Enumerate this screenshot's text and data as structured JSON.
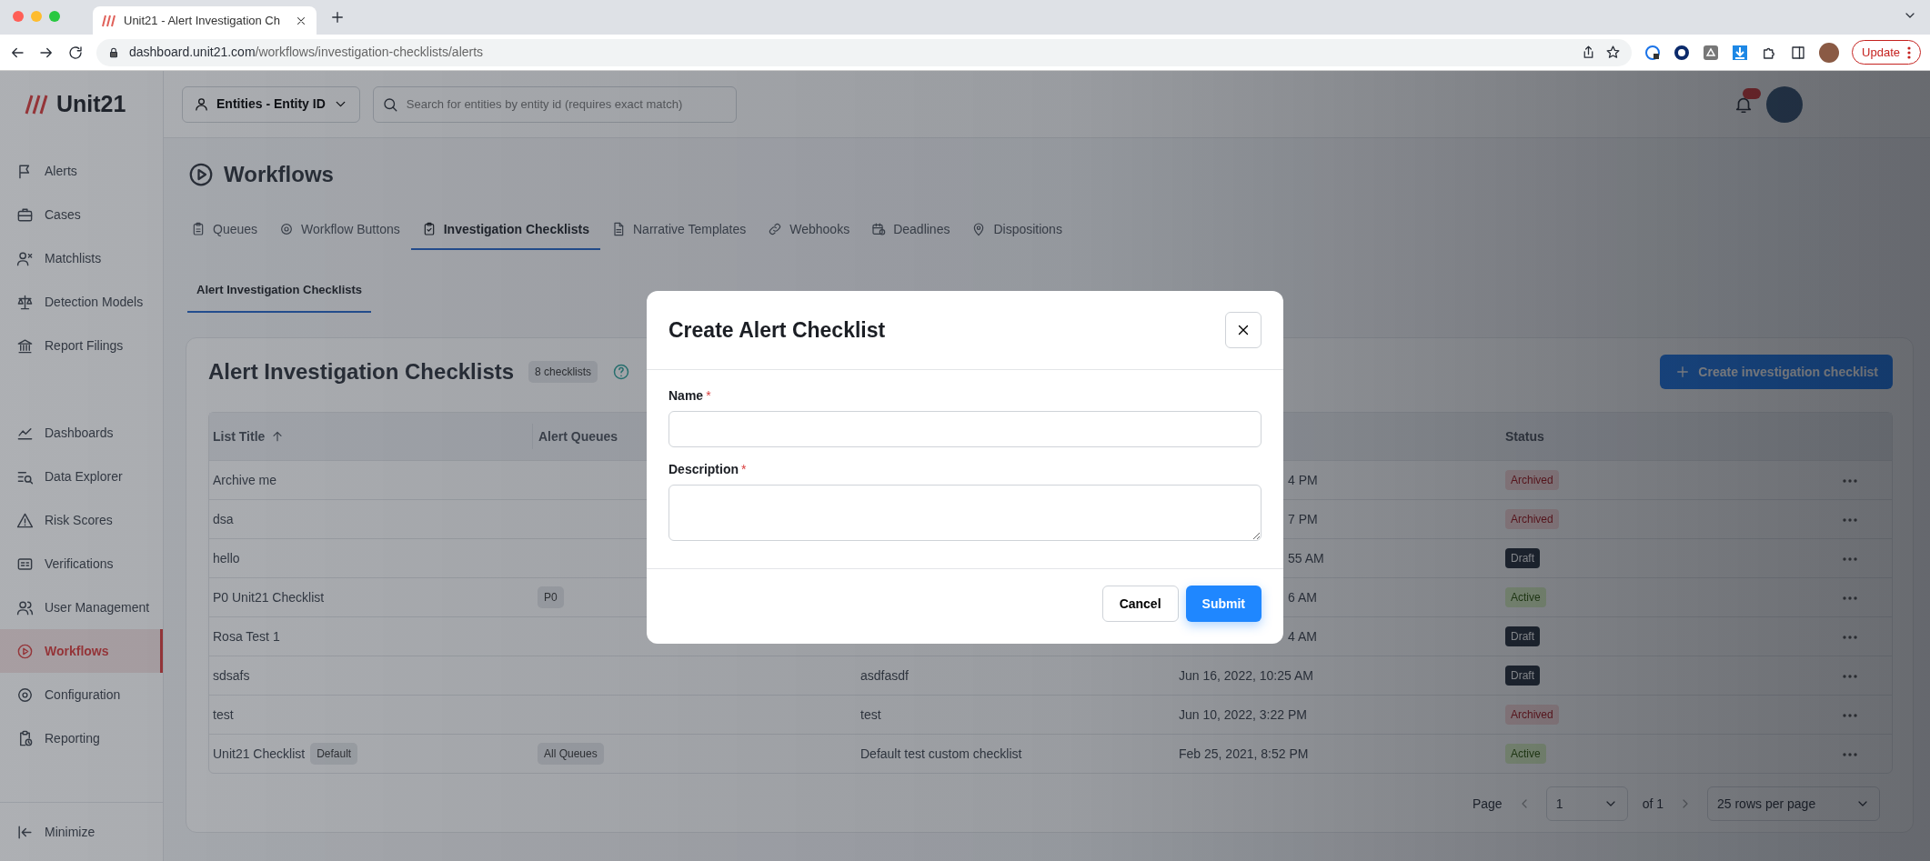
{
  "browser": {
    "tab_title": "Unit21 - Alert Investigation Ch",
    "url_host": "dashboard.unit21.com",
    "url_path": "/workflows/investigation-checklists/alerts",
    "update_button": "Update"
  },
  "app": {
    "logo": "Unit21",
    "entity_selector": "Entities - Entity ID",
    "search_placeholder": "Search for entities by entity id (requires exact match)"
  },
  "sidebar": {
    "groups": [
      [
        {
          "label": "Alerts",
          "selected": false
        },
        {
          "label": "Cases",
          "selected": false
        },
        {
          "label": "Matchlists",
          "selected": false
        },
        {
          "label": "Detection Models",
          "selected": false
        },
        {
          "label": "Report Filings",
          "selected": false
        }
      ],
      [
        {
          "label": "Dashboards",
          "selected": false
        },
        {
          "label": "Data Explorer",
          "selected": false
        },
        {
          "label": "Risk Scores",
          "selected": false
        },
        {
          "label": "Verifications",
          "selected": false
        },
        {
          "label": "User Management",
          "selected": false
        },
        {
          "label": "Workflows",
          "selected": true
        },
        {
          "label": "Configuration",
          "selected": false
        },
        {
          "label": "Reporting",
          "selected": false
        }
      ]
    ],
    "minimize": "Minimize"
  },
  "page": {
    "title": "Workflows",
    "tabs": [
      {
        "label": "Queues",
        "selected": false
      },
      {
        "label": "Workflow Buttons",
        "selected": false
      },
      {
        "label": "Investigation Checklists",
        "selected": true
      },
      {
        "label": "Narrative Templates",
        "selected": false
      },
      {
        "label": "Webhooks",
        "selected": false
      },
      {
        "label": "Deadlines",
        "selected": false
      },
      {
        "label": "Dispositions",
        "selected": false
      }
    ],
    "subtabs": [
      {
        "label": "Alert Investigation Checklists",
        "selected": true
      }
    ]
  },
  "card": {
    "title": "Alert Investigation Checklists",
    "count_badge": "8 checklists",
    "create_button": "Create investigation checklist",
    "table": {
      "header": {
        "list_title": "List Title",
        "alert_queues": "Alert Queues",
        "status": "Status"
      },
      "rows": [
        {
          "title": "Archive me",
          "updated_tail": "4 PM",
          "status": {
            "label": "Archived",
            "kind": "archived"
          }
        },
        {
          "title": "dsa",
          "updated_tail": "7 PM",
          "status": {
            "label": "Archived",
            "kind": "archived"
          }
        },
        {
          "title": "hello",
          "updated_tail": "55 AM",
          "status": {
            "label": "Draft",
            "kind": "draft"
          }
        },
        {
          "title": "P0 Unit21 Checklist",
          "queue": "P0",
          "updated_tail": "6 AM",
          "status": {
            "label": "Active",
            "kind": "active"
          }
        },
        {
          "title": "Rosa Test 1",
          "updated_tail": "4 AM",
          "status": {
            "label": "Draft",
            "kind": "draft"
          }
        },
        {
          "title": "sdsafs",
          "description": "asdfasdf",
          "updated": "Jun 16, 2022, 10:25 AM",
          "status": {
            "label": "Draft",
            "kind": "draft"
          }
        },
        {
          "title": "test",
          "description": "test",
          "updated": "Jun 10, 2022, 3:22 PM",
          "status": {
            "label": "Archived",
            "kind": "archived"
          }
        },
        {
          "title": "Unit21 Checklist",
          "title_badge": "Default",
          "queue": "All Queues",
          "description": "Default test custom checklist",
          "updated": "Feb 25, 2021, 8:52 PM",
          "status": {
            "label": "Active",
            "kind": "active"
          }
        }
      ]
    },
    "pagination": {
      "page_label": "Page",
      "page_value": "1",
      "of": "of 1",
      "rows_per_page": "25 rows per page"
    }
  },
  "dialog": {
    "title": "Create Alert Checklist",
    "fields": [
      {
        "label": "Name",
        "required_mark": "*",
        "kind": "input"
      },
      {
        "label": "Description",
        "required_mark": "*",
        "kind": "textarea"
      }
    ],
    "cancel": "Cancel",
    "submit": "Submit"
  }
}
